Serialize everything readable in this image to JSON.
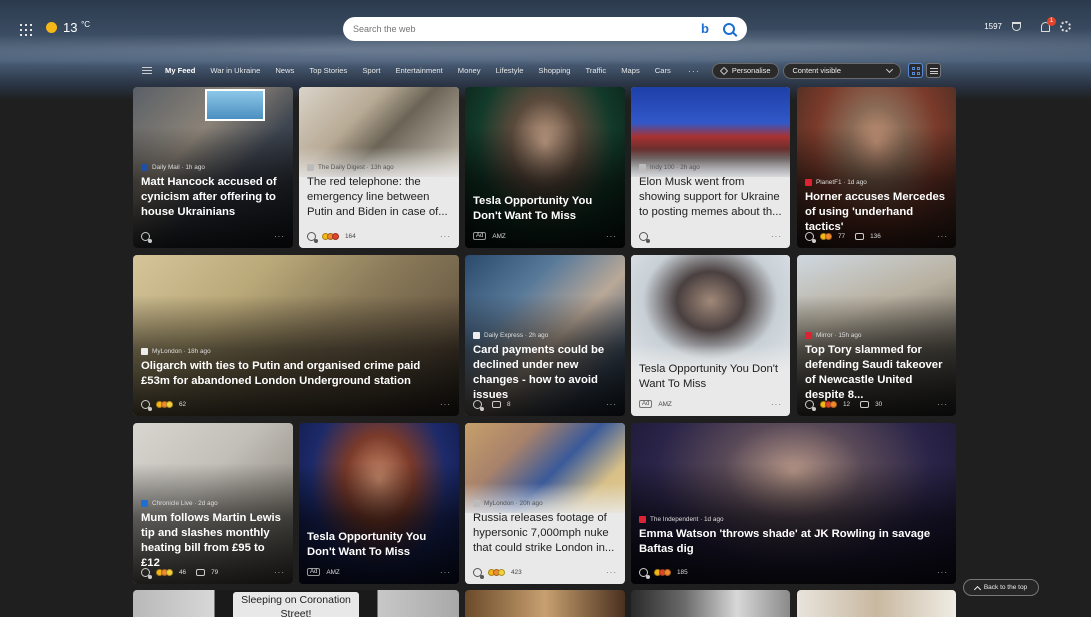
{
  "weather": {
    "temp": "13",
    "unit": "°C"
  },
  "search": {
    "placeholder": "Search the web"
  },
  "rewards": {
    "points": "1597"
  },
  "notifications": {
    "count": "1"
  },
  "nav": {
    "items": [
      "My Feed",
      "War in Ukraine",
      "News",
      "Top Stories",
      "Sport",
      "Entertainment",
      "Money",
      "Lifestyle",
      "Shopping",
      "Traffic",
      "Maps",
      "Cars"
    ],
    "personalise": "Personalise",
    "content_select": "Content visible"
  },
  "cards": [
    {
      "source": "Daily Mail · 1h ago",
      "headline": "Matt Hancock accused of cynicism after offering to house Ukrainians",
      "count": "",
      "comments": ""
    },
    {
      "source": "The Daily Digest · 13h ago",
      "headline": "The red telephone: the emergency line between Putin and Biden in case of...",
      "count": "164",
      "comments": ""
    },
    {
      "source": "",
      "headline": "Tesla Opportunity You Don't Want To Miss",
      "ad": "Ad",
      "advertiser": "AMZ"
    },
    {
      "source": "Indy 100 · 2h ago",
      "headline": "Elon Musk went from showing support for Ukraine to posting memes about th...",
      "count": "",
      "comments": ""
    },
    {
      "source": "PlanetF1 · 1d ago",
      "headline": "Horner accuses Mercedes of using 'underhand tactics'",
      "count": "77",
      "comments": "136"
    },
    {
      "source": "MyLondon · 18h ago",
      "headline": "Oligarch with ties to Putin and organised crime paid £53m for abandoned London Underground station",
      "count": "62",
      "comments": ""
    },
    {
      "source": "Daily Express · 2h ago",
      "headline": "Card payments could be declined under new changes - how to avoid issues",
      "count": "",
      "comments": "8"
    },
    {
      "source": "",
      "headline": "Tesla Opportunity You Don't Want To Miss",
      "ad": "Ad",
      "advertiser": "AMZ"
    },
    {
      "source": "Mirror · 15h ago",
      "headline": "Top Tory slammed for defending Saudi takeover of Newcastle United despite 8...",
      "count": "12",
      "comments": "30"
    },
    {
      "source": "Chronicle Live · 2d ago",
      "headline": "Mum follows Martin Lewis tip and slashes monthly heating bill from £95 to £12",
      "count": "46",
      "comments": "79"
    },
    {
      "source": "",
      "headline": "Tesla Opportunity You Don't Want To Miss",
      "ad": "Ad",
      "advertiser": "AMZ"
    },
    {
      "source": "MyLondon · 20h ago",
      "headline": "Russia releases footage of hypersonic 7,000mph nuke that could strike London in...",
      "count": "423",
      "comments": ""
    },
    {
      "source": "The Independent · 1d ago",
      "headline": "Emma Watson 'throws shade' at JK Rowling in savage Baftas dig",
      "count": "185",
      "comments": ""
    }
  ],
  "bottom_caption": "Sleeping on Coronation Street!",
  "back_to_top": "Back to the top",
  "colors": {
    "accent": "#1b6fd1",
    "background": "#1f1f1f",
    "badge": "#e0452b"
  }
}
